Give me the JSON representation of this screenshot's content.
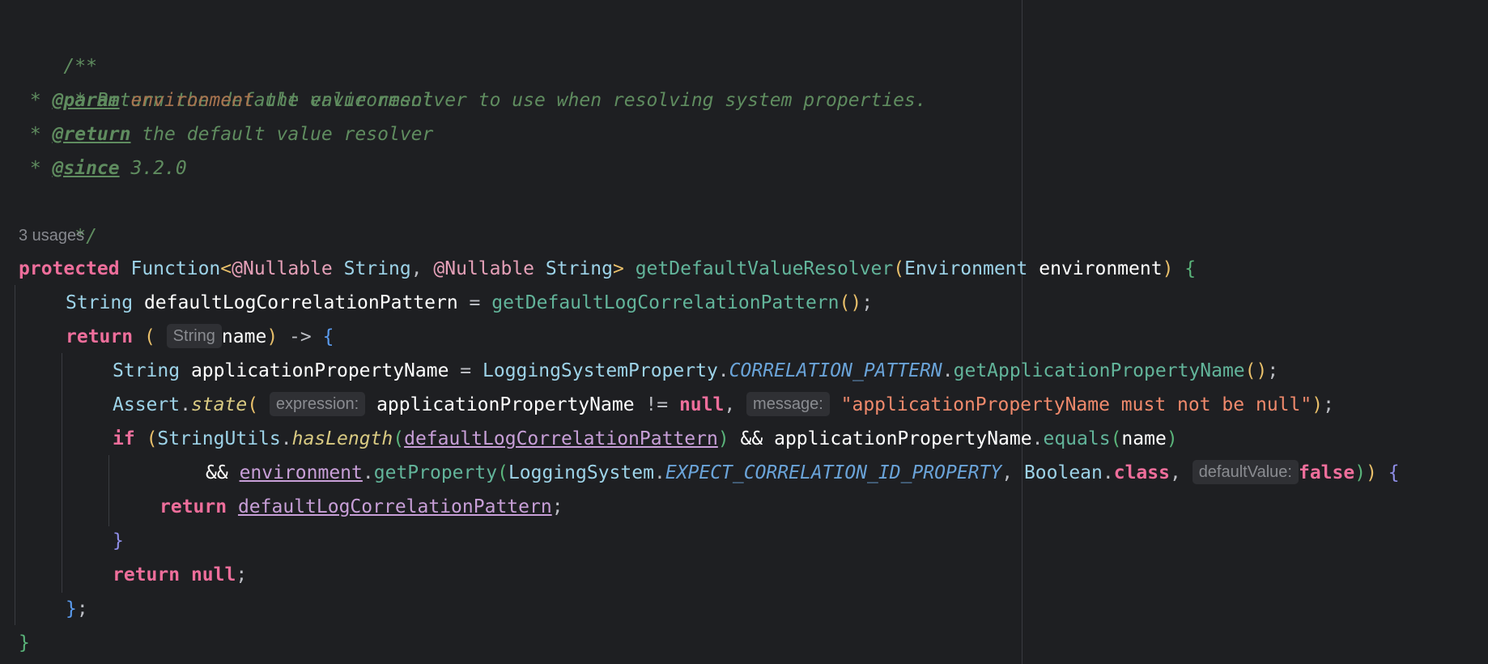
{
  "editor": {
    "usages_label": "3 usages",
    "javadoc": {
      "open": "/**",
      "summary": " * Return the default value resolver to use when resolving system properties.",
      "star": " * ",
      "param_tag": "@param",
      "param_name": "environment",
      "param_desc": " the environment",
      "return_tag": "@return",
      "return_desc": " the default value resolver",
      "since_tag": "@since",
      "since_value": " 3.2.0",
      "close": " */"
    },
    "tokens": {
      "protected": "protected",
      "function_type": "Function",
      "lt": "<",
      "gt": ">",
      "nullable": "@Nullable",
      "string": "String",
      "comma": ", ",
      "method_name": "getDefaultValueResolver",
      "lparen": "(",
      "rparen": ")",
      "environment_type": "Environment",
      "environment_param": "environment",
      "lbrace": "{",
      "rbrace": "}",
      "default_pattern_var": "defaultLogCorrelationPattern",
      "assign": " = ",
      "get_default_pattern": "getDefaultLogCorrelationPattern",
      "empty_call": "()",
      "semicolon": ";",
      "return": "return",
      "name": "name",
      "arrow": " -> ",
      "app_prop_name": "applicationPropertyName",
      "logging_system_property": "LoggingSystemProperty",
      "dot": ".",
      "correlation_pattern": "CORRELATION_PATTERN",
      "get_app_prop_name": "getApplicationPropertyName",
      "assert": "Assert",
      "state": "state",
      "neq": " != ",
      "null": "null",
      "message_string": "\"applicationPropertyName must not be null\"",
      "if": "if",
      "string_utils": "StringUtils",
      "has_length": "hasLength",
      "and": "&&",
      "equals": "equals",
      "get_property": "getProperty",
      "logging_system": "LoggingSystem",
      "expect_corr_prop": "EXPECT_CORRELATION_ID_PROPERTY",
      "boolean": "Boolean",
      "class_kw": "class",
      "false": "false"
    },
    "hints": {
      "string_type": "String",
      "expression": "expression:",
      "message": "message:",
      "default_value": "defaultValue:"
    }
  }
}
